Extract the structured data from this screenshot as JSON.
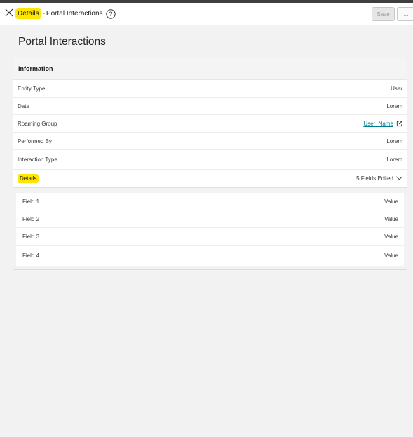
{
  "header": {
    "breadcrumb_highlight": "Details",
    "breadcrumb_separator": "-",
    "title": "Portal Interactions",
    "save_label": "Save",
    "more_label": "..."
  },
  "page": {
    "title": "Portal Interactions"
  },
  "info_card": {
    "title": "Information",
    "rows": [
      {
        "label": "Entity Type",
        "value": "User"
      },
      {
        "label": "Date",
        "value": "Lorem"
      },
      {
        "label": "Roaming Group",
        "value": "User_Name"
      },
      {
        "label": "Performed By",
        "value": "Lorem"
      },
      {
        "label": "Interaction Type",
        "value": "Lorem"
      }
    ],
    "details": {
      "label": "Details",
      "summary": "5 Fields Edited"
    }
  },
  "fields": [
    {
      "label": "Field 1",
      "value": "Value"
    },
    {
      "label": "Field 2",
      "value": "Value"
    },
    {
      "label": "Field 3",
      "value": "Value"
    },
    {
      "label": "Field 4",
      "value": "Value"
    }
  ],
  "icons": {
    "close": "close-icon",
    "help": "help-circle-icon",
    "external": "external-link-icon",
    "chevron": "chevron-down-icon"
  },
  "colors": {
    "highlight": "#ffe600",
    "link": "#007c92",
    "background": "#f2f2f2"
  }
}
